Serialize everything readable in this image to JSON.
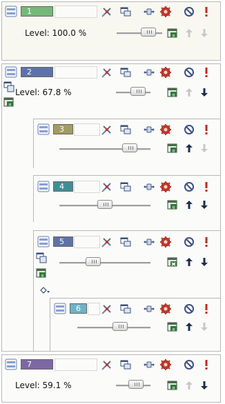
{
  "colors": {
    "green": "#76b87a",
    "blue": "#5d73a8",
    "olive": "#a39b62",
    "teal": "#3f8e96",
    "lightblue": "#6fb2c6",
    "purple": "#7e68a4"
  },
  "channels": [
    {
      "number": "1",
      "color": "green",
      "level": "Level: 100.0 %",
      "fader_fraction": 1.0,
      "selected": true
    },
    {
      "number": "2",
      "color": "blue",
      "level": "Level:  67.8 %",
      "fader_fraction": 0.678
    },
    {
      "number": "3",
      "color": "olive",
      "level": "",
      "fader_fraction": 0.75
    },
    {
      "number": "4",
      "color": "teal",
      "level": "",
      "fader_fraction": 0.5
    },
    {
      "number": "5",
      "color": "blue",
      "level": "",
      "fader_fraction": 0.4
    },
    {
      "number": "6",
      "color": "lightblue",
      "level": "",
      "fader_fraction": 0.5
    },
    {
      "number": "7",
      "color": "purple",
      "level": "Level:  59.1 %",
      "fader_fraction": 0.591
    }
  ],
  "icons": [
    "mixer-icon",
    "window-icon",
    "link-icon",
    "gear-icon",
    "disable-icon",
    "exclamation-icon",
    "image-alpha-icon",
    "arrow-up-icon",
    "arrow-down-icon"
  ]
}
